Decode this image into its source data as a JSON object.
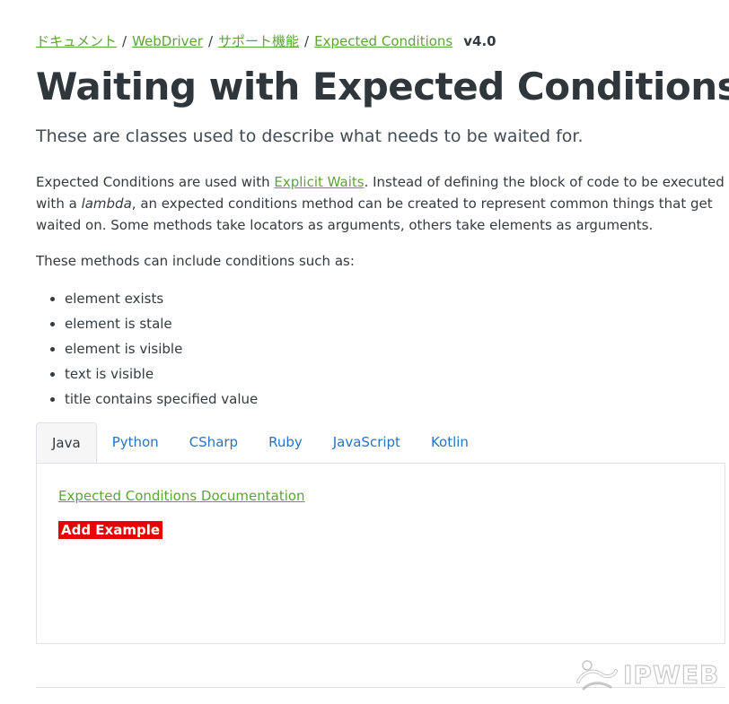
{
  "breadcrumb": {
    "items": [
      {
        "label": "ドキュメント"
      },
      {
        "label": "WebDriver"
      },
      {
        "label": "サポート機能"
      },
      {
        "label": "Expected Conditions"
      }
    ],
    "separator": "/",
    "version": "v4.0"
  },
  "title": "Waiting with Expected Conditions",
  "lead": "These are classes used to describe what needs to be waited for.",
  "intro": {
    "before_link": "Expected Conditions are used with ",
    "link": "Explicit Waits",
    "after_link": ". Instead of defining the block of code to be executed with a ",
    "emphasis": "lambda",
    "rest": ", an expected conditions method can be created to represent common things that get waited on. Some methods take locators as arguments, others take elements as arguments."
  },
  "list_intro": "These methods can include conditions such as:",
  "conditions": [
    "element exists",
    "element is stale",
    "element is visible",
    "text is visible",
    "title contains specified value"
  ],
  "tabs": [
    {
      "label": "Java",
      "active": true
    },
    {
      "label": "Python"
    },
    {
      "label": "CSharp"
    },
    {
      "label": "Ruby"
    },
    {
      "label": "JavaScript"
    },
    {
      "label": "Kotlin"
    }
  ],
  "panel": {
    "doc_link": "Expected Conditions Documentation",
    "add_example": "Add Example"
  },
  "watermark": "IPWEB",
  "colors": {
    "link_green": "#5fa339",
    "tab_blue": "#2a72c2",
    "badge_red": "#e60000",
    "text": "#333a40"
  }
}
